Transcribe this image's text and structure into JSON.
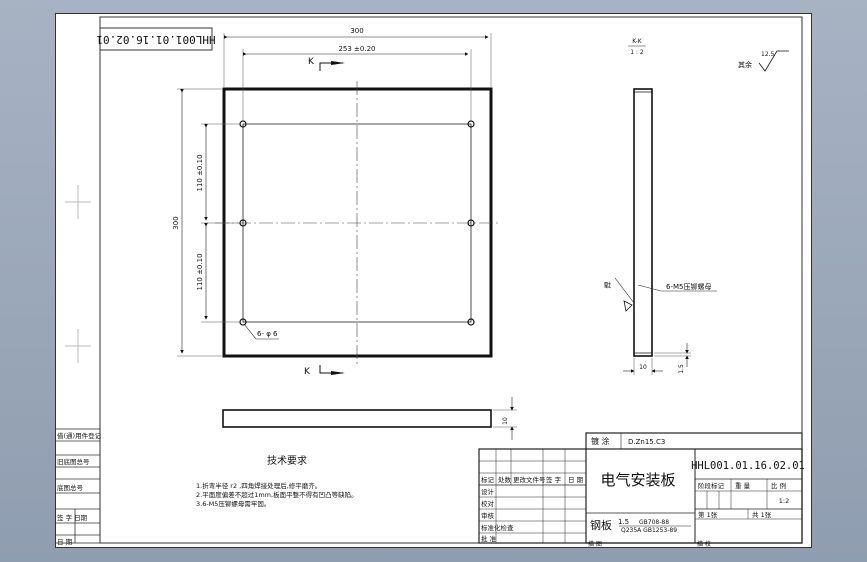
{
  "drawing": {
    "code_box": "HHL001.01.16.02.01",
    "title": "电气安装板",
    "code": "HHL001.01.16.02.01",
    "material_main": "钢板",
    "material_thickness": "1.5",
    "material_std1": "GB708-88",
    "material_std2": "Q235A GB1253-89",
    "coating_label": "镀 涂",
    "coating_value": "D.Zn15.C3",
    "scale": "1:2",
    "sheet_label": "第 1张",
    "sheets_label": "共 1张",
    "section_label": "K-K",
    "section_scale": "1 : 2",
    "roughness_value": "12.5",
    "roughness_label": "其余"
  },
  "dims": {
    "overall_width": "300",
    "hole_span": "253 ±0.20",
    "overall_height": "300",
    "hole_pitch_upper": "110 ±0.10",
    "hole_pitch_lower": "110 ±0.10",
    "hole_note": "6- φ 6",
    "cut_top": "K",
    "cut_bottom": "K",
    "edge_thickness": "10",
    "side_thickness": "10",
    "side_offset": "1.5",
    "weld_label": "焊",
    "nut_label": "6-M5压铆螺母"
  },
  "tech": {
    "heading": "技术要求",
    "items": [
      "1.折弯半径 r2 ,四角焊接处理后,修平磨齐。",
      "2.平面度偏差不超过1mm,板面平整不得有凹凸等缺陷。",
      "3.6-M5压铆螺母需牢固。"
    ]
  },
  "left_cells": [
    "借(通)用件登记",
    "旧底图总号",
    "底图总号",
    "签 字 日期",
    "日 期"
  ],
  "title_block": {
    "labels": [
      "标记",
      "处数",
      "更改文件号",
      "签 字",
      "日 期"
    ],
    "roles": [
      "设计",
      "校对",
      "审核"
    ],
    "std_check": "标准化检查",
    "approve": "批 准",
    "stage": "阶段标记",
    "weight": "重 量",
    "ratio": "比 例",
    "bottom_left": "描 图",
    "bottom_right": "描 校"
  }
}
